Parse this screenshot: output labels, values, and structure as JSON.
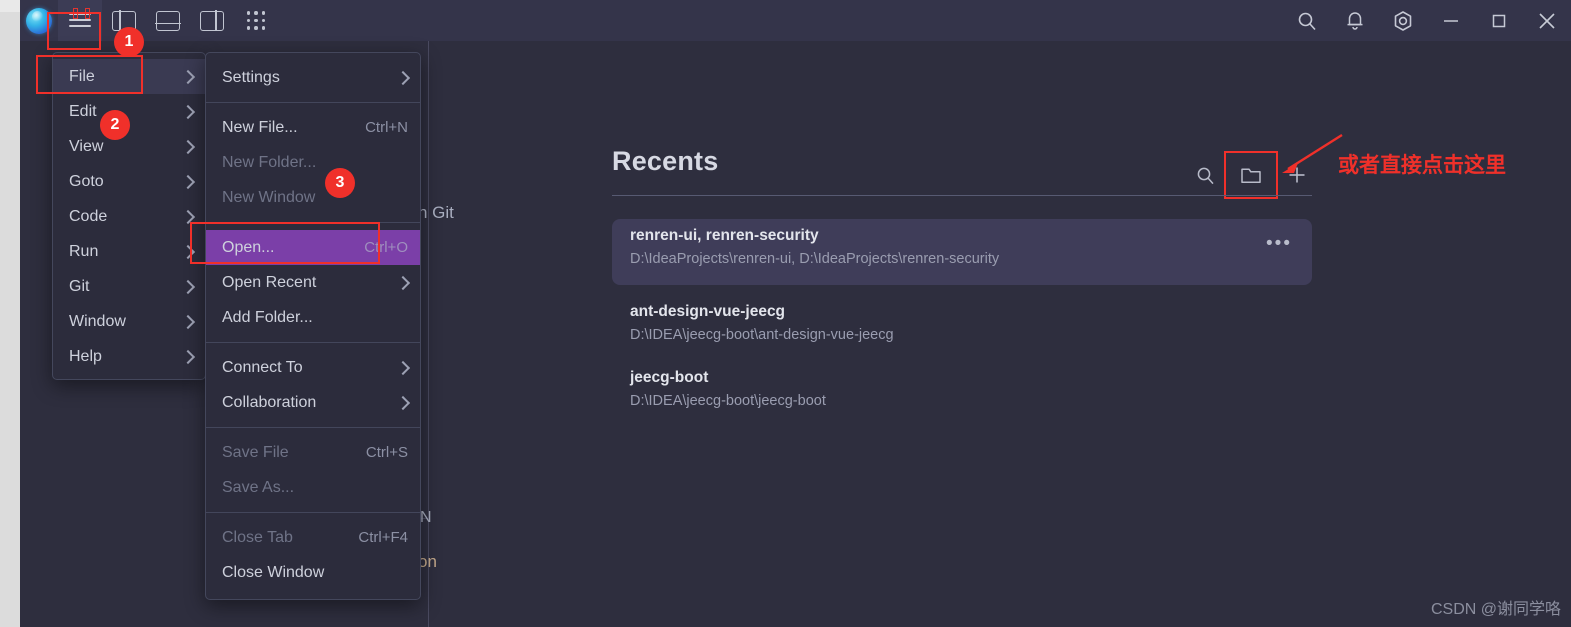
{
  "window": {
    "titlebar": {
      "logo_icon": "app-logo-icon",
      "left_buttons": [
        {
          "name": "menu-hamburger-button",
          "icon": "hamburger-icon",
          "active": true
        },
        {
          "name": "toggle-left-panel-button",
          "icon": "panel-left-icon",
          "active": false
        },
        {
          "name": "toggle-bottom-panel-button",
          "icon": "panel-bottom-icon",
          "active": false
        },
        {
          "name": "toggle-right-panel-button",
          "icon": "panel-right-icon",
          "active": false
        },
        {
          "name": "apps-grid-button",
          "icon": "grid-dots-icon",
          "active": false
        }
      ],
      "right_buttons": [
        {
          "name": "search-button",
          "icon": "search-icon"
        },
        {
          "name": "notifications-button",
          "icon": "bell-icon"
        },
        {
          "name": "settings-button",
          "icon": "gear-hex-icon"
        },
        {
          "name": "minimize-button",
          "icon": "minimize-icon"
        },
        {
          "name": "maximize-button",
          "icon": "maximize-icon"
        },
        {
          "name": "close-button",
          "icon": "close-icon"
        }
      ]
    }
  },
  "main_menu": {
    "items": [
      {
        "label": "File",
        "submenu": true,
        "highlighted": true
      },
      {
        "label": "Edit",
        "submenu": true,
        "highlighted": false
      },
      {
        "label": "View",
        "submenu": true,
        "highlighted": false
      },
      {
        "label": "Goto",
        "submenu": true,
        "highlighted": false
      },
      {
        "label": "Code",
        "submenu": true,
        "highlighted": false
      },
      {
        "label": "Run",
        "submenu": true,
        "highlighted": false
      },
      {
        "label": "Git",
        "submenu": true,
        "highlighted": false
      },
      {
        "label": "Window",
        "submenu": true,
        "highlighted": false
      },
      {
        "label": "Help",
        "submenu": true,
        "highlighted": false
      }
    ]
  },
  "file_submenu": {
    "groups": [
      {
        "items": [
          {
            "label": "Settings",
            "shortcut": "",
            "submenu": true,
            "disabled": false,
            "selected": false
          }
        ]
      },
      {
        "items": [
          {
            "label": "New File...",
            "shortcut": "Ctrl+N",
            "submenu": false,
            "disabled": false,
            "selected": false
          },
          {
            "label": "New Folder...",
            "shortcut": "",
            "submenu": false,
            "disabled": true,
            "selected": false
          },
          {
            "label": "New Window",
            "shortcut": "",
            "submenu": false,
            "disabled": true,
            "selected": false
          }
        ]
      },
      {
        "items": [
          {
            "label": "Open...",
            "shortcut": "Ctrl+O",
            "submenu": false,
            "disabled": false,
            "selected": true
          },
          {
            "label": "Open Recent",
            "shortcut": "",
            "submenu": true,
            "disabled": false,
            "selected": false
          },
          {
            "label": "Add Folder...",
            "shortcut": "",
            "submenu": false,
            "disabled": false,
            "selected": false
          }
        ]
      },
      {
        "items": [
          {
            "label": "Connect To",
            "shortcut": "",
            "submenu": true,
            "disabled": false,
            "selected": false
          },
          {
            "label": "Collaboration",
            "shortcut": "",
            "submenu": true,
            "disabled": false,
            "selected": false
          }
        ]
      },
      {
        "items": [
          {
            "label": "Save File",
            "shortcut": "Ctrl+S",
            "submenu": false,
            "disabled": true,
            "selected": false
          },
          {
            "label": "Save As...",
            "shortcut": "",
            "submenu": false,
            "disabled": true,
            "selected": false
          }
        ]
      },
      {
        "items": [
          {
            "label": "Close Tab",
            "shortcut": "Ctrl+F4",
            "submenu": false,
            "disabled": true,
            "selected": false
          },
          {
            "label": "Close Window",
            "shortcut": "",
            "submenu": false,
            "disabled": false,
            "selected": false
          }
        ]
      }
    ]
  },
  "recents": {
    "title": "Recents",
    "tools": [
      {
        "name": "recents-search-icon",
        "icon": "search-icon",
        "boxed": false
      },
      {
        "name": "open-folder-icon",
        "icon": "folder-icon",
        "boxed": true
      },
      {
        "name": "add-new-icon",
        "icon": "plus-icon",
        "boxed": false
      }
    ],
    "items": [
      {
        "name": "renren-ui, renren-security",
        "path": "D:\\IdeaProjects\\renren-ui, D:\\IdeaProjects\\renren-security",
        "selected": true,
        "more": "•••"
      },
      {
        "name": "ant-design-vue-jeecg",
        "path": "D:\\IDEA\\jeecg-boot\\ant-design-vue-jeecg",
        "selected": false,
        "more": ""
      },
      {
        "name": "jeecg-boot",
        "path": "D:\\IDEA\\jeecg-boot\\jeecg-boot",
        "selected": false,
        "more": ""
      }
    ]
  },
  "background_text": {
    "fragment_git": "n Git",
    "fragment_n": "N",
    "fragment_on": "on"
  },
  "annotations": {
    "badges": [
      {
        "label": "1",
        "target": "hamburger-button"
      },
      {
        "label": "2",
        "target": "main-menu-file"
      },
      {
        "label": "3",
        "target": "open-menu-item"
      }
    ],
    "note_text": "或者直接点击这里",
    "accent_color": "#f0302a"
  },
  "watermark": "CSDN @谢同学咯"
}
